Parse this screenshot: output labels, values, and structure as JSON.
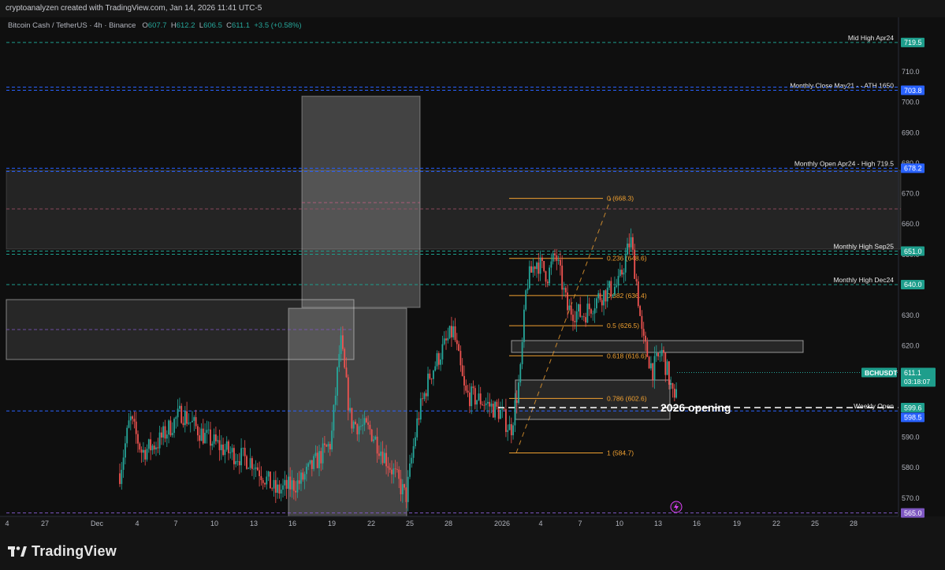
{
  "header": {
    "credit": "cryptoanalyzen created with TradingView.com, Jan 14, 2026 11:41 UTC-5",
    "symbol": "Bitcoin Cash / TetherUS · 4h · Binance",
    "ohlc": {
      "o_label": "O",
      "o": "607.7",
      "h_label": "H",
      "h": "612.2",
      "l_label": "L",
      "l": "606.5",
      "c_label": "C",
      "c": "611.1",
      "change": "+3.5 (+0.58%)"
    }
  },
  "brand": {
    "name": "TradingView"
  },
  "colors": {
    "up": "#26a69a",
    "down": "#ef5350",
    "fib": "#f0a030",
    "level_teal": "#1e9e8c",
    "level_blue": "#2962ff",
    "level_purple": "#7e57c2",
    "weekly_open": "#2962ff"
  },
  "chart_data": {
    "type": "candlestick",
    "timeframe": "4h",
    "ylim": [
      563,
      725
    ],
    "y_ticks": [
      570,
      580,
      590,
      600,
      610,
      620,
      630,
      640,
      650,
      660,
      670,
      680,
      690,
      700,
      710
    ],
    "x_ticks": [
      "4",
      "27",
      "Dec",
      "4",
      "7",
      "10",
      "13",
      "16",
      "19",
      "22",
      "25",
      "28",
      "2026",
      "4",
      "7",
      "10",
      "13",
      "16",
      "19",
      "22",
      "25",
      "28"
    ],
    "price_badges": [
      {
        "value": "719.5",
        "kind": "teal"
      },
      {
        "value": "703.8",
        "kind": "blue"
      },
      {
        "value": "678.2",
        "kind": "blue"
      },
      {
        "value": "651.0",
        "kind": "teal"
      },
      {
        "value": "640.0",
        "kind": "teal"
      },
      {
        "value": "599.6",
        "kind": "teal"
      },
      {
        "value": "598.5",
        "kind": "blue"
      },
      {
        "value": "565.0",
        "kind": "purple"
      }
    ],
    "current_price": {
      "ticker": "BCHUSDT",
      "price": "611.1",
      "countdown": "03:18:07",
      "value": 611.1
    },
    "levels": [
      {
        "label": "Mid High Apr24",
        "value": 719.5,
        "style": "teal"
      },
      {
        "label": "Monthly Close May21 - - ATH 1650",
        "value": 703.8,
        "style": "blue"
      },
      {
        "label": "Monthly Open Apr24 - High 719.5",
        "value": 678.2,
        "style": "blue"
      },
      {
        "label": "Monthly High Sep25",
        "value": 651.0,
        "style": "teal"
      },
      {
        "label": "Monthly High Dec24",
        "value": 640.0,
        "style": "teal"
      },
      {
        "label": "Weekly Open",
        "value": 598.5,
        "style": "blue"
      },
      {
        "label": "",
        "value": 565.0,
        "style": "purple"
      }
    ],
    "annotation": {
      "label": "2026 opening",
      "value": 599.6
    },
    "fibonacci": [
      {
        "label": "0 (668.3)",
        "value": 668.3
      },
      {
        "label": "0.236 (648.6)",
        "value": 648.6
      },
      {
        "label": "0.382 (636.4)",
        "value": 636.4
      },
      {
        "label": "0.5 (626.5)",
        "value": 626.5
      },
      {
        "label": "0.618 (616.6)",
        "value": 616.6
      },
      {
        "label": "0.786 (602.6)",
        "value": 602.6
      },
      {
        "label": "1 (584.7)",
        "value": 584.7
      }
    ]
  }
}
